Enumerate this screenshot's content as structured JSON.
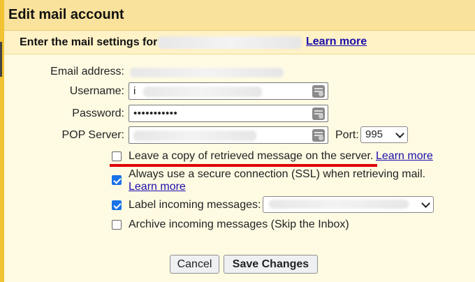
{
  "dialog": {
    "title": "Edit mail account",
    "subtitle": "Enter the mail settings for",
    "subtitle_learn_more": "Learn more"
  },
  "form": {
    "email_label": "Email address:",
    "username_label": "Username:",
    "username_value": "i",
    "password_label": "Password:",
    "password_value": "•••••••••••",
    "pop_server_label": "POP Server:",
    "port_label": "Port:",
    "port_value": "995"
  },
  "options": {
    "leave_copy": {
      "label": "Leave a copy of retrieved message on the server.",
      "learn_more": "Learn more",
      "checked": false
    },
    "secure_ssl": {
      "label": "Always use a secure connection (SSL) when retrieving mail.",
      "learn_more": "Learn more",
      "checked": true
    },
    "label_incoming": {
      "label": "Label incoming messages:",
      "checked": true
    },
    "archive_incoming": {
      "label": "Archive incoming messages (Skip the Inbox)",
      "checked": false
    }
  },
  "buttons": {
    "cancel": "Cancel",
    "save": "Save Changes"
  },
  "colors": {
    "accent_border": "#f1c232",
    "title_bg": "#f9e29b",
    "checkbox_checked": "#1a73e8",
    "annotation_red": "#e00000"
  }
}
